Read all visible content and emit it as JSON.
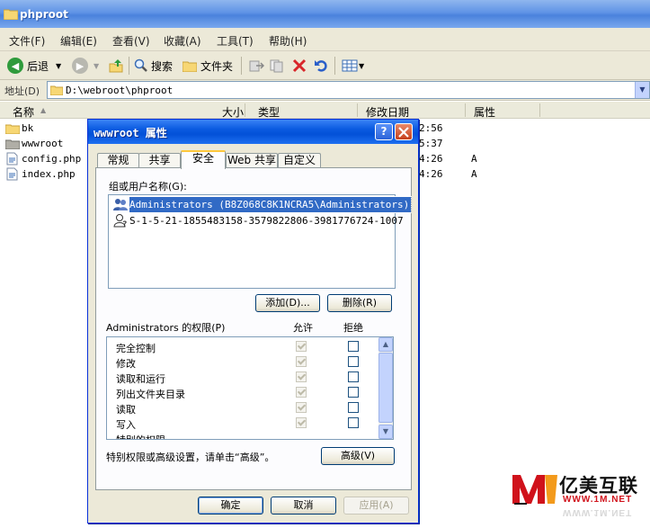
{
  "window": {
    "title": "phproot"
  },
  "menu": [
    "文件(F)",
    "编辑(E)",
    "查看(V)",
    "收藏(A)",
    "工具(T)",
    "帮助(H)"
  ],
  "toolbar": {
    "back_label": "后退",
    "search_label": "搜索",
    "folders_label": "文件夹"
  },
  "address": {
    "label": "地址(D)",
    "path": "D:\\webroot\\phproot"
  },
  "columns": {
    "name": "名称",
    "size": "大小",
    "type": "类型",
    "modified": "修改日期",
    "attrs": "属性"
  },
  "files": [
    {
      "name": "bk",
      "icon": "folder-icon",
      "modified_tail": "2:56",
      "attr": ""
    },
    {
      "name": "wwwroot",
      "icon": "folder-shared-icon",
      "modified_tail": "5:37",
      "attr": ""
    },
    {
      "name": "config.php",
      "icon": "file-icon",
      "modified_tail": "4:26",
      "attr": "A"
    },
    {
      "name": "index.php",
      "icon": "file-icon",
      "modified_tail": "4:26",
      "attr": "A"
    }
  ],
  "dialog": {
    "title": "wwwroot 属性",
    "help_label": "?",
    "tabs": [
      "常规",
      "共享",
      "安全",
      "Web 共享",
      "自定义"
    ],
    "active_tab": "安全",
    "group_label": "组或用户名称(G):",
    "users": [
      {
        "name": "Administrators (B8Z068C8K1NCRA5\\Administrators)",
        "icon": "user-group-icon",
        "selected": true
      },
      {
        "name": "S-1-5-21-1855483158-3579822806-3981776724-1007",
        "icon": "unknown-user-icon",
        "selected": false
      }
    ],
    "add_label": "添加(D)...",
    "remove_label": "删除(R)",
    "perm_header": "Administrators 的权限(P)",
    "allow_header": "允许",
    "deny_header": "拒绝",
    "permissions": [
      {
        "name": "完全控制",
        "allow": true,
        "deny": false
      },
      {
        "name": "修改",
        "allow": true,
        "deny": false
      },
      {
        "name": "读取和运行",
        "allow": true,
        "deny": false
      },
      {
        "name": "列出文件夹目录",
        "allow": true,
        "deny": false
      },
      {
        "name": "读取",
        "allow": true,
        "deny": false
      },
      {
        "name": "写入",
        "allow": true,
        "deny": false
      },
      {
        "name": "特别的权限",
        "allow": false,
        "deny": false
      }
    ],
    "special_note": "特别权限或高级设置，请单击“高级”。",
    "advanced_label": "高级(V)",
    "ok_label": "确定",
    "cancel_label": "取消",
    "apply_label": "应用(A)"
  },
  "watermark": {
    "brand": "亿美互联",
    "url": "WWW.1M.NET",
    "colors": {
      "red": "#d0121b",
      "orange": "#f39a1b"
    }
  },
  "colors": {
    "xp_blue": "#0a5ae0",
    "selection": "#316ac5",
    "face": "#ece9d8"
  }
}
